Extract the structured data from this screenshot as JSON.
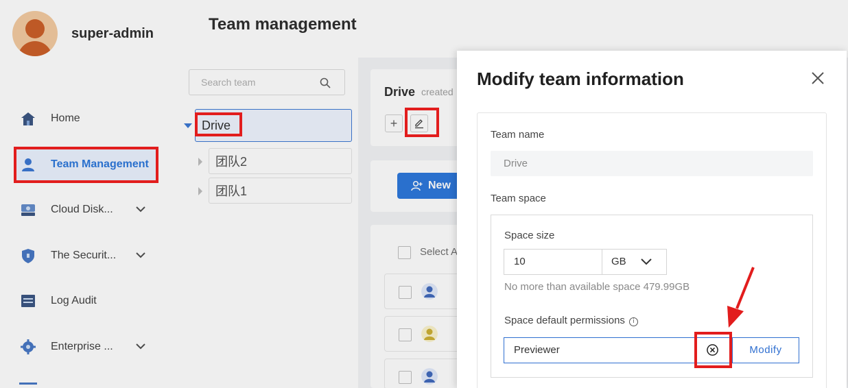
{
  "user": {
    "name": "super-admin"
  },
  "nav": {
    "items": [
      {
        "label": "Home",
        "icon": "house-icon",
        "active": false,
        "expandable": false
      },
      {
        "label": "Team Management",
        "icon": "person-icon",
        "active": true,
        "expandable": false
      },
      {
        "label": "Cloud Disk...",
        "icon": "disk-icon",
        "active": false,
        "expandable": true
      },
      {
        "label": "The Securit...",
        "icon": "shield-icon",
        "active": false,
        "expandable": true
      },
      {
        "label": "Log Audit",
        "icon": "log-icon",
        "active": false,
        "expandable": false
      },
      {
        "label": "Enterprise ...",
        "icon": "gear-icon",
        "active": false,
        "expandable": true
      }
    ]
  },
  "page": {
    "title": "Team management"
  },
  "team_tree": {
    "search_placeholder": "Search team",
    "nodes": [
      {
        "label": "Drive",
        "selected": true,
        "expanded": true
      },
      {
        "label": "团队2",
        "selected": false,
        "expanded": false
      },
      {
        "label": "团队1",
        "selected": false,
        "expanded": false
      }
    ]
  },
  "detail": {
    "team_name": "Drive",
    "subtitle": "created",
    "add_label": "+",
    "new_button_label": "New",
    "select_all_label": "Select A"
  },
  "modal": {
    "title": "Modify team information",
    "team_name_label": "Team name",
    "team_name_value": "Drive",
    "team_space_label": "Team space",
    "space_size_label": "Space size",
    "space_size_value": "10",
    "space_unit": "GB",
    "space_hint": "No more than available space 479.99GB",
    "permissions_label": "Space default permissions",
    "permissions_value": "Previewer",
    "modify_label": "Modify"
  },
  "colors": {
    "accent": "#1e6fd9",
    "annotation": "#e21d1d"
  }
}
